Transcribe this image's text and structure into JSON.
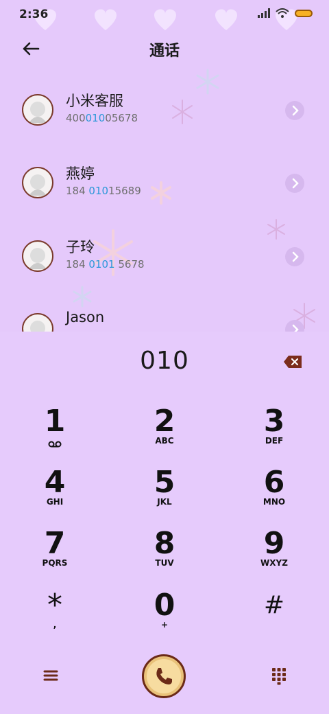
{
  "status_bar": {
    "time": "2:36",
    "icons": [
      "signal-icon",
      "wifi-icon",
      "battery-icon"
    ]
  },
  "header": {
    "title": "通话",
    "back_icon": "back-arrow-icon"
  },
  "contacts": [
    {
      "name": "小米客服",
      "number_pre": "400",
      "number_hl": "010",
      "number_post": "05678"
    },
    {
      "name": "燕婷",
      "number_pre": "184 ",
      "number_hl": "010",
      "number_post": "15689"
    },
    {
      "name": "子玲",
      "number_pre": "184 ",
      "number_hl": "0101",
      "number_post": " 5678"
    },
    {
      "name": "Jason",
      "number_pre": "",
      "number_hl": "",
      "number_post": ""
    }
  ],
  "dialer": {
    "input_value": "010",
    "keys": [
      {
        "num": "1",
        "letters": ""
      },
      {
        "num": "2",
        "letters": "ABC"
      },
      {
        "num": "3",
        "letters": "DEF"
      },
      {
        "num": "4",
        "letters": "GHI"
      },
      {
        "num": "5",
        "letters": "JKL"
      },
      {
        "num": "6",
        "letters": "MNO"
      },
      {
        "num": "7",
        "letters": "PQRS"
      },
      {
        "num": "8",
        "letters": "TUV"
      },
      {
        "num": "9",
        "letters": "WXYZ"
      },
      {
        "num": "*",
        "letters": ","
      },
      {
        "num": "0",
        "letters": "+"
      },
      {
        "num": "#",
        "letters": ""
      }
    ]
  },
  "colors": {
    "background": "#e5c9fb",
    "highlight": "#2a97d8",
    "accent_brown": "#6b2a17",
    "call_gold": "#e9c27a"
  }
}
